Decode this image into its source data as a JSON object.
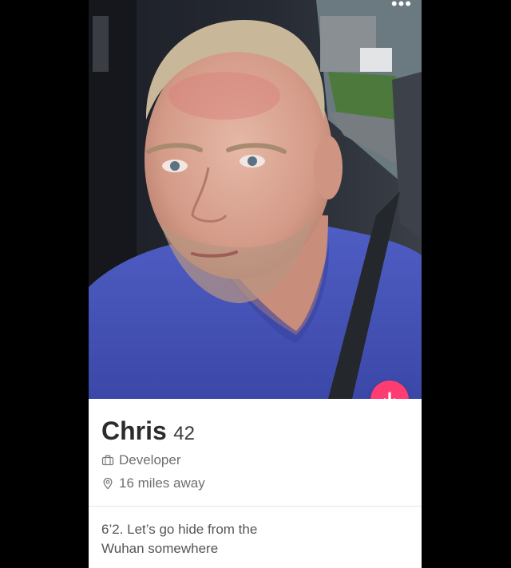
{
  "profile": {
    "name": "Chris",
    "age": "42",
    "job": "Developer",
    "distance": "16 miles away",
    "bio": "6’2.  Let’s go hide from the\nWuhan somewhere"
  },
  "icons": {
    "more": "ellipsis-icon",
    "collapse": "arrow-down-icon",
    "job": "briefcase-icon",
    "distance": "location-pin-icon"
  },
  "colors": {
    "accent": "#fe3c72",
    "background": "#000000",
    "card": "#ffffff",
    "name_text": "#2c2c2c",
    "secondary_text": "#6f6f6f"
  },
  "header": {
    "more_label": "•••"
  }
}
